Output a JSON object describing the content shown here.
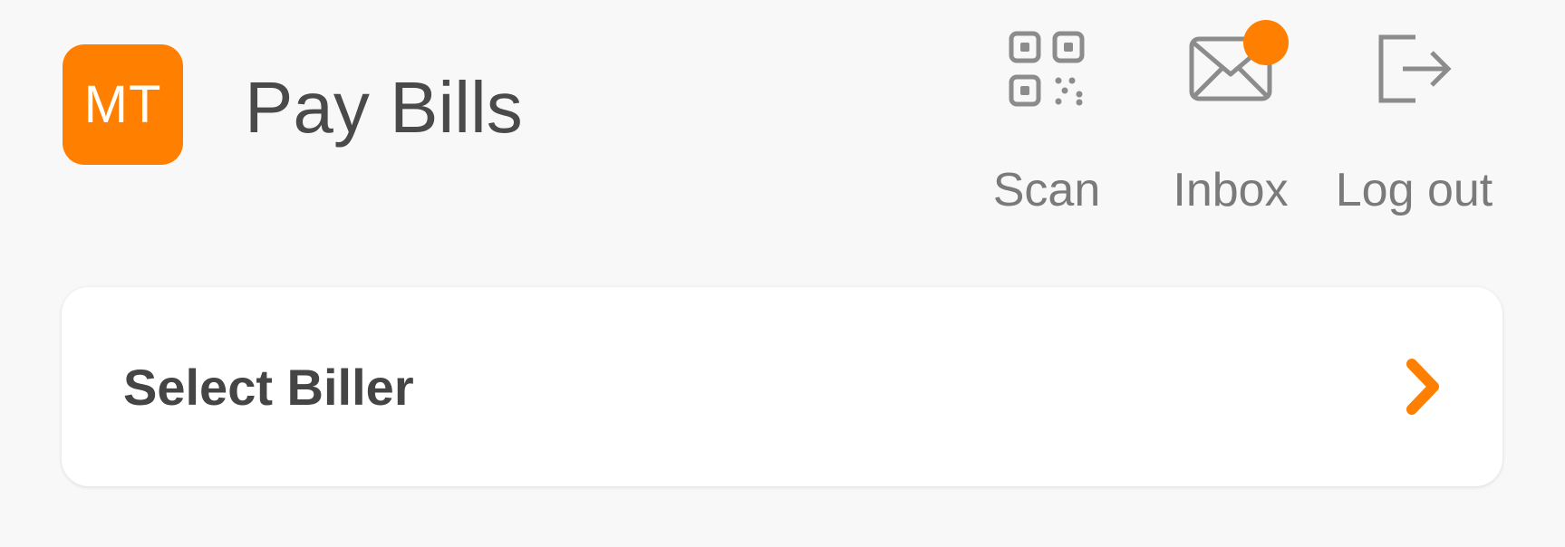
{
  "header": {
    "avatar_initials": "MT",
    "title": "Pay Bills",
    "actions": [
      {
        "label": "Scan",
        "icon": "qr-code-icon"
      },
      {
        "label": "Inbox",
        "icon": "envelope-icon",
        "has_notification": true
      },
      {
        "label": "Log out",
        "icon": "logout-icon"
      }
    ]
  },
  "biller_card": {
    "label": "Select Biller",
    "icon": "chevron-right-icon"
  },
  "colors": {
    "accent": "#ff8000",
    "background": "#f8f8f8",
    "card": "#ffffff",
    "title_text": "#4a4a4a",
    "muted_text": "#7a7a7a"
  }
}
